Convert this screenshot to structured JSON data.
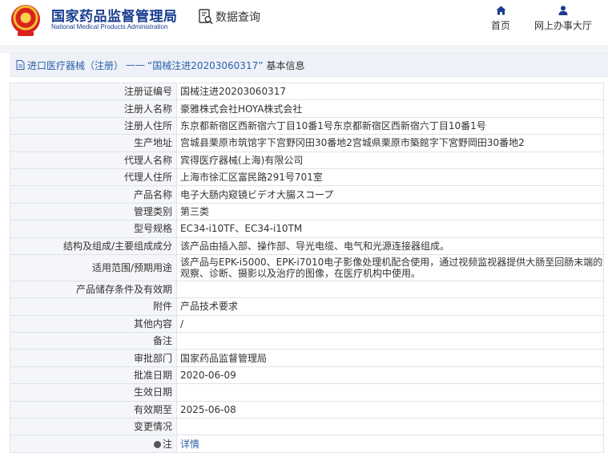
{
  "header": {
    "brand_cn": "国家药品监督管理局",
    "brand_en": "National Medical Products Administration",
    "query_label": "数据查询",
    "nav": [
      {
        "label": "首页",
        "icon": "home-icon"
      },
      {
        "label": "网上办事大厅",
        "icon": "user-icon"
      }
    ]
  },
  "breadcrumb": {
    "section": "进口医疗器械（注册）",
    "dash": "——",
    "current": "“国械注进20203060317”",
    "suffix": "基本信息"
  },
  "colors": {
    "brand": "#1a3d8f",
    "link": "#2b5fab",
    "label_bg": "#f5f6f9",
    "border": "#dfe3ea"
  },
  "fields": [
    {
      "label": "注册证编号",
      "value": "国械注进20203060317"
    },
    {
      "label": "注册人名称",
      "value": "豪雅株式会社HOYA株式会社"
    },
    {
      "label": "注册人住所",
      "value": "东京都新宿区西新宿六丁目10番1号东京都新宿区西新宿六丁目10番1号"
    },
    {
      "label": "生产地址",
      "value": "宫城县栗原市筑馆字下宫野冈田30番地2宫城県栗原市築館字下宮野岡田30番地2"
    },
    {
      "label": "代理人名称",
      "value": "宾得医疗器械(上海)有限公司"
    },
    {
      "label": "代理人住所",
      "value": "上海市徐汇区富民路291号701室"
    },
    {
      "label": "产品名称",
      "value": "电子大肠内窥镜ビデオ大腸スコープ"
    },
    {
      "label": "管理类别",
      "value": "第三类"
    },
    {
      "label": "型号规格",
      "value": "EC34-i10TF、EC34-i10TM"
    },
    {
      "label": "结构及组成/主要组成成分",
      "value": "该产品由插入部、操作部、导光电缆、电气和光源连接器组成。"
    },
    {
      "label": "适用范围/预期用途",
      "value": "该产品与EPK-i5000、EPK-i7010电子影像处理机配合使用，通过视频监视器提供大肠至回肠末端的观察、诊断、摄影以及治疗的图像，在医疗机构中使用。"
    },
    {
      "label": "产品储存条件及有效期",
      "value": ""
    },
    {
      "label": "附件",
      "value": "产品技术要求"
    },
    {
      "label": "其他内容",
      "value": "/"
    },
    {
      "label": "备注",
      "value": ""
    },
    {
      "label": "审批部门",
      "value": "国家药品监督管理局"
    },
    {
      "label": "批准日期",
      "value": "2020-06-09"
    },
    {
      "label": "生效日期",
      "value": ""
    },
    {
      "label": "有效期至",
      "value": "2025-06-08"
    },
    {
      "label": "变更情况",
      "value": ""
    },
    {
      "label": "注",
      "value": "详情"
    }
  ]
}
